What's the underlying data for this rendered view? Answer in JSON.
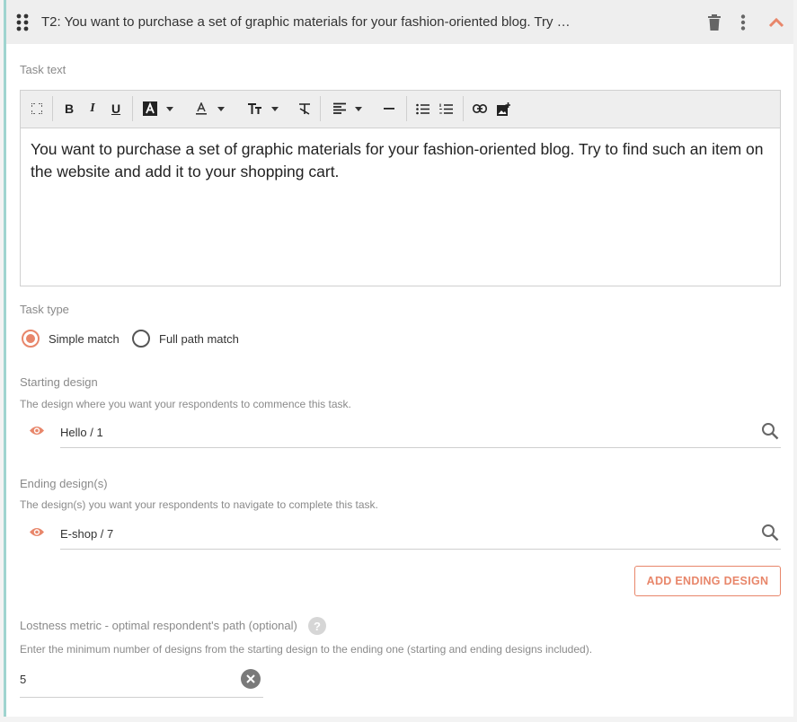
{
  "header": {
    "title": "T2: You want to purchase a set of graphic materials for your fashion-oriented blog. Try to find such an item on the website and add it to your shopping cart."
  },
  "task_text": {
    "label": "Task text",
    "content": "You want to purchase a set of graphic materials for your fashion-oriented blog. Try to find such an item on the website and add it to your shopping cart.",
    "toolbar": {
      "bold": "B",
      "italic": "I",
      "underline": "U"
    }
  },
  "task_type": {
    "label": "Task type",
    "options": [
      {
        "label": "Simple match",
        "selected": true
      },
      {
        "label": "Full path match",
        "selected": false
      }
    ]
  },
  "starting_design": {
    "label": "Starting design",
    "hint": "The design where you want your respondents to commence this task.",
    "value": "Hello / 1"
  },
  "ending_designs": {
    "label": "Ending design(s)",
    "hint": "The design(s) you want your respondents to navigate to complete this task.",
    "value": "E-shop / 7",
    "add_button": "ADD ENDING DESIGN"
  },
  "lostness": {
    "label": "Lostness metric - optimal respondent's path (optional)",
    "help": "?",
    "hint": "Enter the minimum number of designs from the starting design to the ending one (starting and ending designs included).",
    "value": "5"
  },
  "colors": {
    "accent": "#e8866a",
    "left_border": "#9fd4cf",
    "header_bg": "#eeeeee"
  }
}
